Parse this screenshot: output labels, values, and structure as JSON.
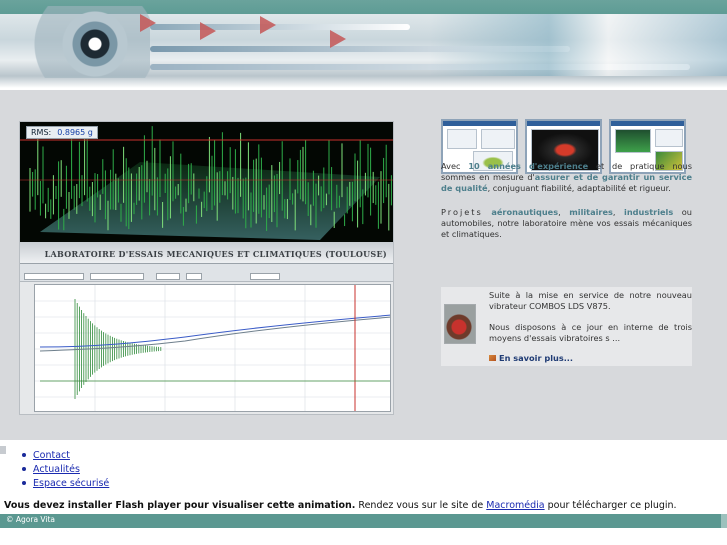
{
  "lab_image": {
    "rms_label": "RMS:",
    "rms_value": "0.8965 g",
    "title": "LABORATOIRE D'ESSAIS MECANIQUES ET CLIMATIQUES (TOULOUSE)"
  },
  "intro": {
    "prefix": "Avec",
    "experience": "10 années d'expérience",
    "middle": "et de pratique nous sommes en mesure d'",
    "commitment": "assurer et de garantir un service de qualité",
    "suffix": ", conjuguant fiabilité, adaptabilité et rigueur."
  },
  "projects": {
    "label": "Projets",
    "aero": "aéronautiques",
    "mil": "militaires",
    "indus": "industriels",
    "rest": "ou automobiles, notre laboratoire mène vos essais mécaniques et climatiques."
  },
  "news": {
    "p1": "Suite à la mise en service de notre nouveau vibrateur COMBOS LDS V875.",
    "p2": "Nous disposons à ce jour en interne de trois moyens d'essais vibratoires s ...",
    "more": "En savoir plus..."
  },
  "nav": {
    "items": [
      {
        "label": "Contact"
      },
      {
        "label": "Actualités"
      },
      {
        "label": "Espace sécurisé"
      }
    ]
  },
  "flash": {
    "bold": "Vous devez installer Flash player pour visualiser cette animation.",
    "text": "Rendez vous sur le site de",
    "link": "Macromédia",
    "tail": "pour télécharger ce plugin."
  },
  "footer": {
    "copyright": "© Agora Vita"
  },
  "colors": {
    "teal": "#5b9891",
    "highlight": "#4d7f8c",
    "link": "#1a2ab0"
  }
}
